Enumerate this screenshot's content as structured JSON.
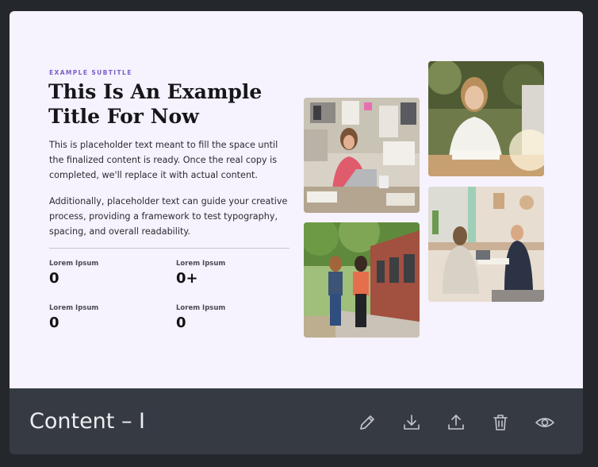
{
  "preview": {
    "subtitle": "EXAMPLE SUBTITLE",
    "title": "This Is An Example Title For Now",
    "paragraphs": [
      "This is placeholder text meant to fill the space until the finalized content is ready. Once the real copy is completed, we'll replace it with actual content.",
      "Additionally, placeholder text can guide your creative process, providing a framework to test typography, spacing, and overall readability."
    ],
    "stats": [
      {
        "label": "Lorem Ipsum",
        "value": "0"
      },
      {
        "label": "Lorem Ipsum",
        "value": "0+"
      },
      {
        "label": "Lorem Ipsum",
        "value": "0"
      },
      {
        "label": "Lorem Ipsum",
        "value": "0"
      }
    ],
    "accent_color": "#7a5fc8",
    "background_color": "#f6f2fe"
  },
  "footer": {
    "title": "Content – I",
    "actions": [
      {
        "icon": "pencil-icon",
        "name": "edit"
      },
      {
        "icon": "download-icon",
        "name": "download"
      },
      {
        "icon": "upload-icon",
        "name": "upload"
      },
      {
        "icon": "trash-icon",
        "name": "delete"
      },
      {
        "icon": "eye-icon",
        "name": "preview"
      }
    ]
  }
}
